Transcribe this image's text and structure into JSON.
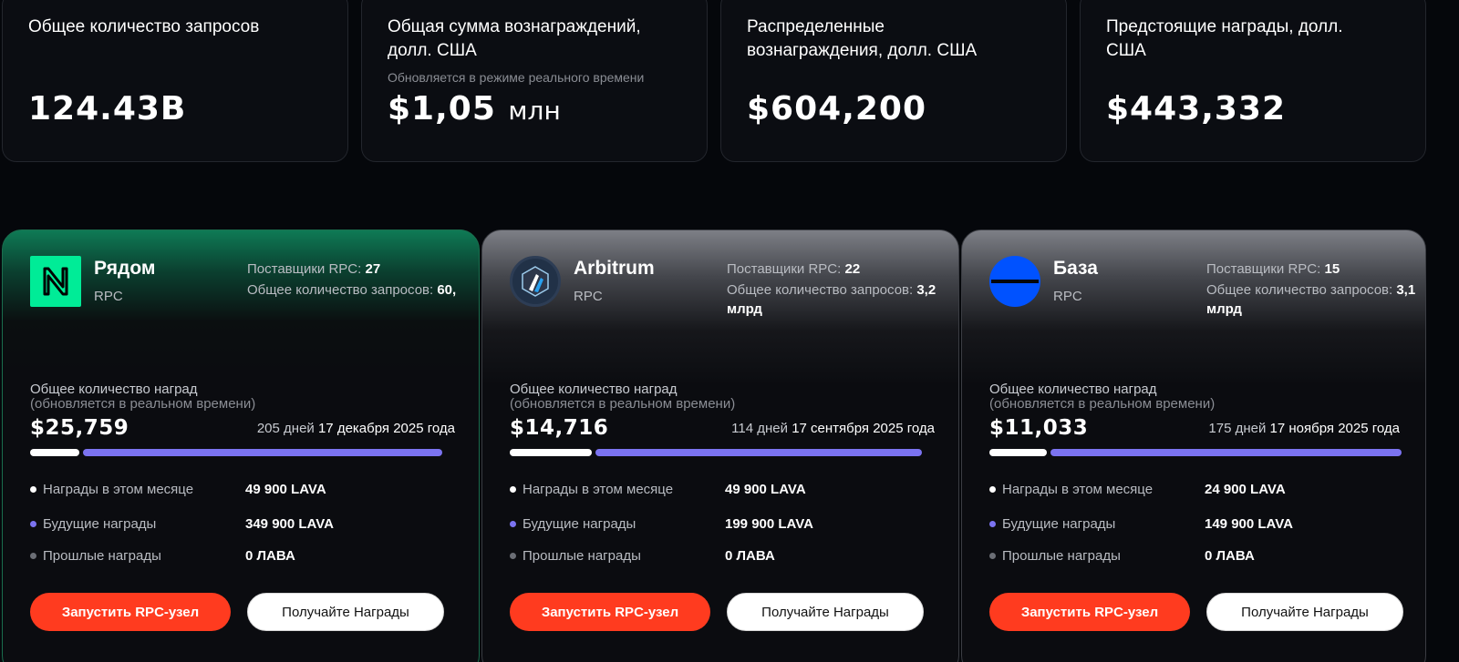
{
  "stats": [
    {
      "title": "Общее количество запросов",
      "sub": "",
      "value": "124.43B",
      "unit": ""
    },
    {
      "title": "Общая сумма вознаграждений, долл. США",
      "sub": "Обновляется в режиме реального времени",
      "value": "$1,05",
      "unit": "млн"
    },
    {
      "title": "Распределенные вознаграждения, долл. США",
      "sub": "",
      "value": "$604,200",
      "unit": ""
    },
    {
      "title": "Предстоящие награды, долл. США",
      "sub": "",
      "value": "$443,332",
      "unit": ""
    }
  ],
  "labels": {
    "providers": "Поставщики RPC:",
    "requests": "Общее количество запросов:",
    "total_rewards": "Общее количество наград",
    "realtime": "(обновляется в реальном времени)",
    "this_month": "Награды в этом месяце",
    "future": "Будущие награды",
    "past": "Прошлые награды",
    "run_node": "Запустить RPC-узел",
    "get_rewards": "Получайте Награды"
  },
  "colors": {
    "dot_month": "#ffffff",
    "dot_future": "#7b73f0",
    "dot_past": "#6b6e75",
    "accent": "#ff3b1f"
  },
  "cards": [
    {
      "name": "Рядом",
      "type": "RPC",
      "icon": "near-logo-icon",
      "providers": "27",
      "requests": "60,",
      "total": "$25,759",
      "days": "205 дней",
      "date": "17 декабря 2025 года",
      "progress": 0.12,
      "month": "49 900 LAVA",
      "future": "349 900 LAVA",
      "past": "0 ЛАВА"
    },
    {
      "name": "Arbitrum",
      "type": "RPC",
      "icon": "arbitrum-logo-icon",
      "providers": "22",
      "requests": "3,2 млрд",
      "total": "$14,716",
      "days": "114 дней",
      "date": "17 сентября 2025 года",
      "progress": 0.2,
      "month": "49 900 LAVA",
      "future": "199 900 LAVA",
      "past": "0 ЛАВА"
    },
    {
      "name": "База",
      "type": "RPC",
      "icon": "base-logo-icon",
      "providers": "15",
      "requests": "3,1 млрд",
      "total": "$11,033",
      "days": "175 дней",
      "date": "17 ноября 2025 года",
      "progress": 0.14,
      "month": "24 900 LAVA",
      "future": "149 900 LAVA",
      "past": "0 ЛАВА"
    }
  ]
}
